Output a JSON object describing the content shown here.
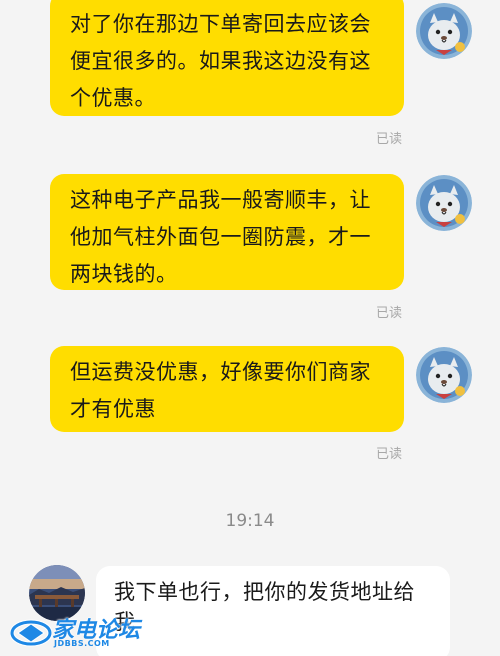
{
  "messages": [
    {
      "text": "对了你在那边下单寄回去应该会便宜很多的。如果我这边没有这个优惠。",
      "status": "已读"
    },
    {
      "text": "这种电子产品我一般寄顺丰，让他加气柱外面包一圈防震，才一两块钱的。",
      "status": "已读"
    },
    {
      "text": "但运费没优惠，好像要你们商家才有优惠",
      "status": "已读"
    }
  ],
  "timestamp": "19:14",
  "incoming": {
    "text": "我下单也行，把你的发货地址给我"
  },
  "watermark": {
    "name": "家电论坛",
    "site": "JDBBS.COM"
  },
  "colors": {
    "outgoing_bubble": "#ffdd00",
    "incoming_bubble": "#ffffff",
    "background": "#f4f4f4"
  }
}
